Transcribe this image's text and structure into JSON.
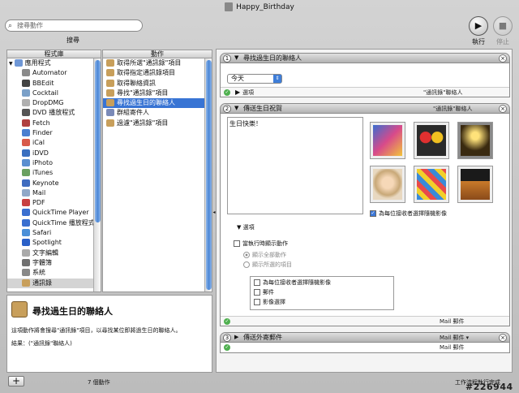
{
  "window": {
    "title": "Happy_Birthday"
  },
  "toolbar": {
    "search_placeholder": "搜尋動作",
    "search_label": "搜尋",
    "run_label": "執行",
    "stop_label": "停止"
  },
  "library": {
    "header": "程式庫",
    "items": [
      {
        "label": "應用程式",
        "icon": "applications-folder-icon",
        "color": "#6f97d6"
      },
      {
        "label": "Automator",
        "icon": "automator-icon",
        "color": "#8a8a8a"
      },
      {
        "label": "BBEdit",
        "icon": "bbedit-icon",
        "color": "#444444"
      },
      {
        "label": "Cocktail",
        "icon": "cocktail-icon",
        "color": "#7aa0c8"
      },
      {
        "label": "DropDMG",
        "icon": "dropdmg-icon",
        "color": "#b0b0b0"
      },
      {
        "label": "DVD 播放程式",
        "icon": "dvd-player-icon",
        "color": "#555555"
      },
      {
        "label": "Fetch",
        "icon": "fetch-icon",
        "color": "#b04040"
      },
      {
        "label": "Finder",
        "icon": "finder-icon",
        "color": "#4a7fd0"
      },
      {
        "label": "iCal",
        "icon": "ical-icon",
        "color": "#d85a4a"
      },
      {
        "label": "iDVD",
        "icon": "idvd-icon",
        "color": "#3a6fc0"
      },
      {
        "label": "iPhoto",
        "icon": "iphoto-icon",
        "color": "#5b8fd0"
      },
      {
        "label": "iTunes",
        "icon": "itunes-icon",
        "color": "#6aa060"
      },
      {
        "label": "Keynote",
        "icon": "keynote-icon",
        "color": "#3f6cc0"
      },
      {
        "label": "Mail",
        "icon": "mail-icon",
        "color": "#90a8c8"
      },
      {
        "label": "PDF",
        "icon": "pdf-icon",
        "color": "#c84040"
      },
      {
        "label": "QuickTime Player",
        "icon": "quicktime-icon",
        "color": "#3a6fd0"
      },
      {
        "label": "QuickTime 播放程式",
        "icon": "quicktime-player-icon",
        "color": "#3a6fd0"
      },
      {
        "label": "Safari",
        "icon": "safari-icon",
        "color": "#4a8fd8"
      },
      {
        "label": "Spotlight",
        "icon": "spotlight-icon",
        "color": "#2a60c8"
      },
      {
        "label": "文字編輯",
        "icon": "textedit-icon",
        "color": "#aaaaaa"
      },
      {
        "label": "字體簿",
        "icon": "fontbook-icon",
        "color": "#707070"
      },
      {
        "label": "系統",
        "icon": "system-icon",
        "color": "#888888"
      },
      {
        "label": "通訊錄",
        "icon": "address-book-icon",
        "color": "#c89f5b"
      }
    ]
  },
  "actions": {
    "header": "動作",
    "items": [
      {
        "label": "取得所選\"通訊錄\"項目"
      },
      {
        "label": "取得指定通訊錄項目"
      },
      {
        "label": "取得聯絡資訊"
      },
      {
        "label": "尋找\"通訊錄\"項目"
      },
      {
        "label": "尋找過生日的聯絡人"
      },
      {
        "label": "群組寄件人"
      },
      {
        "label": "過濾\"通訊錄\"項目"
      }
    ]
  },
  "description": {
    "title": "尋找過生日的聯絡人",
    "text": "這項動作將會搜尋\"通訊錄\"項目，以尋找某位即將過生日的聯絡人。",
    "result": "結果：(\"通訊錄\"聯絡人)"
  },
  "footer": {
    "add": "+",
    "count": "7 個動作",
    "status_right": "工作流程執行完成"
  },
  "watermark": "#226944",
  "workflow": {
    "action1": {
      "num": "1",
      "name": "尋找過生日的聯絡人",
      "date_value": "今天",
      "options": "選項",
      "output": "\"通訊錄\"聯絡人"
    },
    "action2": {
      "num": "2",
      "name": "傳送生日祝賀",
      "input": "\"通訊錄\"聯絡人",
      "message": "生日快樂！",
      "random_label": "為每位接收者選擇隨機影像",
      "options": "選項",
      "show_when_run": "當執行時顯示動作",
      "show_all": "顯示全部動作",
      "show_selected": "顯示所選的項目",
      "opt_items": [
        "為每位接收者選擇隨機影像",
        "郵件",
        "影像選擇"
      ],
      "output": "Mail 郵件"
    },
    "action3": {
      "num": "3",
      "name": "傳送外寄郵件",
      "input": "Mail 郵件 ▾",
      "output": "Mail 郵件"
    }
  },
  "colors": {
    "selection": "#3874d4",
    "check_green": "#4fb04f"
  }
}
